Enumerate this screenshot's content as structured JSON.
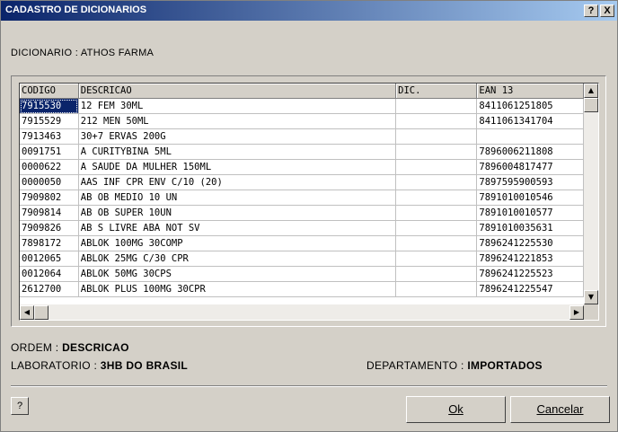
{
  "window": {
    "title": "CADASTRO DE DICIONARIOS",
    "help_glyph": "?",
    "close_glyph": "X"
  },
  "dictionary_label": "DICIONARIO : ATHOS FARMA",
  "table": {
    "columns": [
      "CODIGO",
      "DESCRICAO",
      "DIC.",
      "EAN 13"
    ],
    "rows": [
      [
        "7915530",
        "12 FEM 30ML",
        "",
        "8411061251805"
      ],
      [
        "7915529",
        "212 MEN 50ML",
        "",
        "8411061341704"
      ],
      [
        "7913463",
        "30+7 ERVAS 200G",
        "",
        ""
      ],
      [
        "0091751",
        "A CURITYBINA 5ML",
        "",
        "7896006211808"
      ],
      [
        "0000622",
        "A SAUDE DA MULHER 150ML",
        "",
        "7896004817477"
      ],
      [
        "0000050",
        "AAS INF CPR ENV C/10 (20)",
        "",
        "7897595900593"
      ],
      [
        "7909802",
        "AB OB MEDIO 10 UN",
        "",
        "7891010010546"
      ],
      [
        "7909814",
        "AB OB SUPER 10UN",
        "",
        "7891010010577"
      ],
      [
        "7909826",
        "AB S LIVRE ABA NOT SV",
        "",
        "7891010035631"
      ],
      [
        "7898172",
        "ABLOK 100MG 30COMP",
        "",
        "7896241225530"
      ],
      [
        "0012065",
        "ABLOK 25MG C/30 CPR",
        "",
        "7896241221853"
      ],
      [
        "0012064",
        "ABLOK 50MG 30CPS",
        "",
        "7896241225523"
      ],
      [
        "2612700",
        "ABLOK PLUS 100MG 30CPR",
        "",
        "7896241225547"
      ]
    ],
    "selected_cell": "7915530"
  },
  "scroll_glyphs": {
    "up": "▲",
    "down": "▼",
    "left": "◀",
    "right": "▶"
  },
  "info": {
    "ordem_label": "ORDEM :",
    "ordem_value": "DESCRICAO",
    "laboratorio_label": "LABORATORIO :",
    "laboratorio_value": "3HB DO BRASIL",
    "departamento_label": "DEPARTAMENTO :",
    "departamento_value": "IMPORTADOS"
  },
  "buttons": {
    "help": "?",
    "ok": "Ok",
    "cancel": "Cancelar"
  }
}
